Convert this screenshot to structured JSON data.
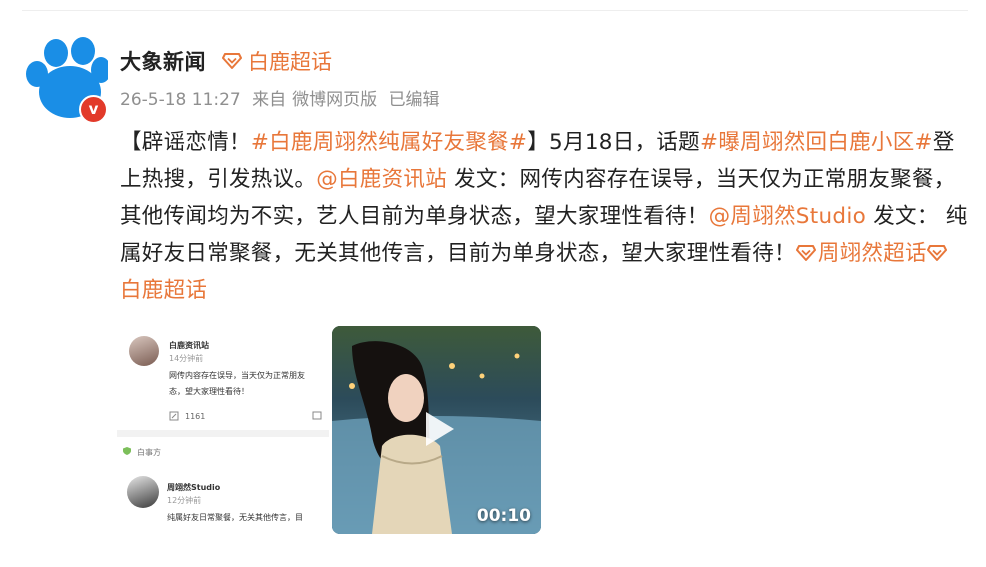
{
  "post": {
    "author": "大象新闻",
    "topic_tag": "白鹿超话",
    "verified_badge": "v",
    "meta": {
      "time": "26-5-18 11:27",
      "source_prefix": "来自",
      "source": "微博网页版",
      "edited": "已编辑"
    },
    "content": {
      "p1": "【辟谣恋情！",
      "h1": "#白鹿周翊然纯属好友聚餐#",
      "p2": "】5月18日，话题",
      "h2": "#曝周翊然回白鹿小区#",
      "p3": "登上热搜，引发热议。",
      "m1": "@白鹿资讯站",
      "p4": " 发文：网传内容存在误导，当天仅为正常朋友聚餐，其他传闻均为不实，艺人目前为单身状态，望大家理性看待！",
      "m2": "@周翊然Studio",
      "p5": " 发文： 纯属好友日常聚餐，无关其他传言，目前为单身状态，望大家理性看待！",
      "t1": "周翊然超话",
      "t2": "白鹿超话"
    },
    "media": {
      "screenshot": {
        "account1": "白鹿资讯站",
        "time1": "14分钟前",
        "text1a": "网传内容存在误导，当天仅为正常朋友",
        "text1b": "态，望大家理性看待！",
        "count1": "1161",
        "source_note": "白事方",
        "account2": "周翊然Studio",
        "time2": "12分钟前",
        "text2": "纯属好友日常聚餐，无关其他传言，目"
      },
      "video": {
        "duration": "00:10"
      }
    }
  },
  "colors": {
    "accent": "#e8773a",
    "text": "#222222",
    "meta": "#8f8f8f",
    "avatar_blue": "#1a8ee6",
    "badge_red": "#e23a2a"
  },
  "icons": [
    "paw-avatar-icon",
    "verified-icon",
    "topic-diamond-icon",
    "play-icon",
    "repost-icon",
    "comment-icon"
  ]
}
